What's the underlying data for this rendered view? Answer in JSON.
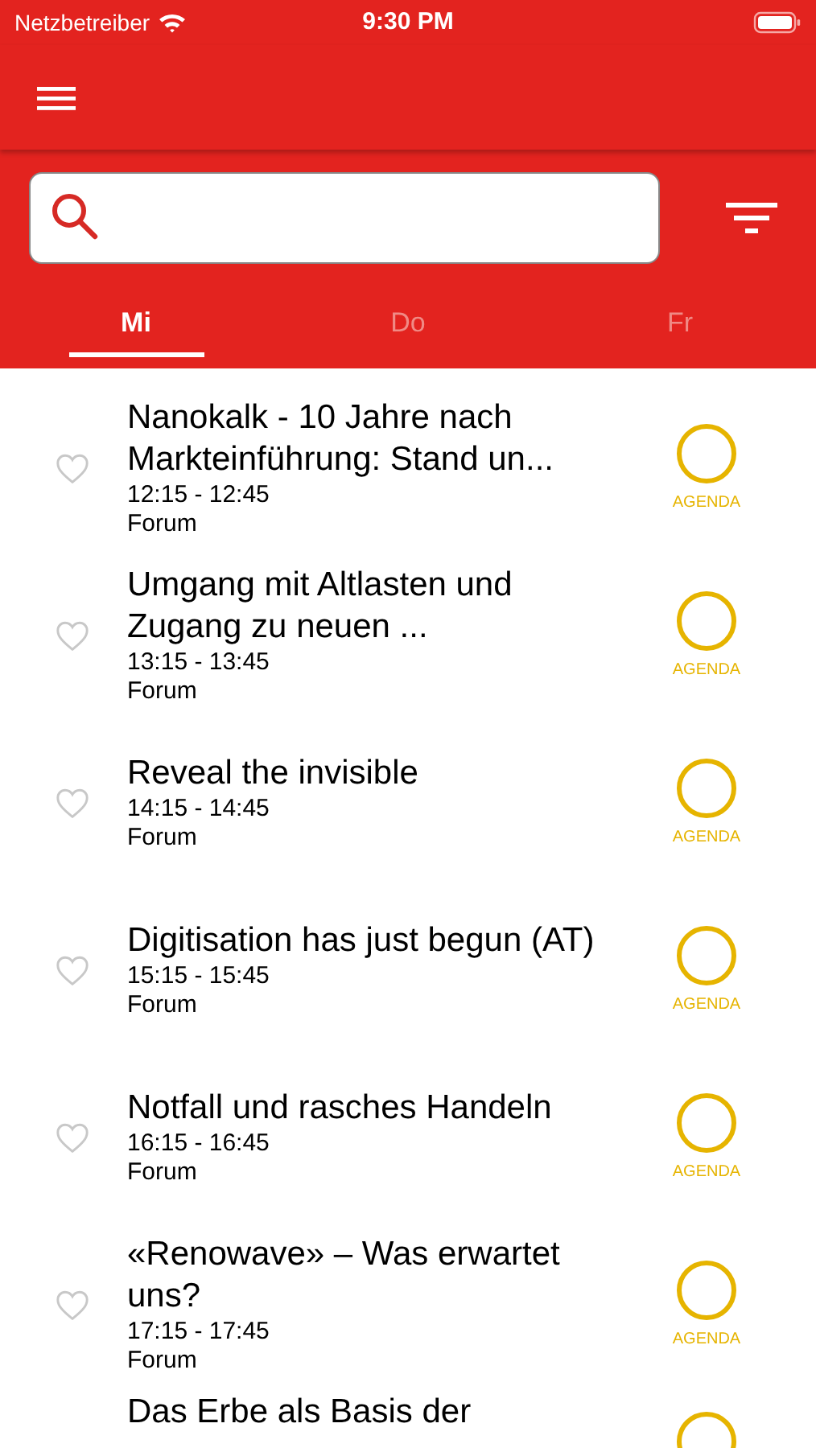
{
  "status_bar": {
    "carrier": "Netzbetreiber",
    "time": "9:30 PM"
  },
  "tabs": [
    {
      "label": "Mi",
      "selected": true
    },
    {
      "label": "Do",
      "selected": false
    },
    {
      "label": "Fr",
      "selected": false
    }
  ],
  "sessions": [
    {
      "title": "Nanokalk - 10 Jahre nach Markteinführung: Stand un...",
      "time": "12:15 - 12:45",
      "room": "Forum",
      "favorite": false,
      "in_agenda": false,
      "agenda_label": "AGENDA"
    },
    {
      "title": "Umgang mit Altlasten und Zugang zu neuen ...",
      "time": "13:15 - 13:45",
      "room": "Forum",
      "favorite": false,
      "in_agenda": false,
      "agenda_label": "AGENDA"
    },
    {
      "title": "Reveal the invisible",
      "time": "14:15 - 14:45",
      "room": "Forum",
      "favorite": false,
      "in_agenda": false,
      "agenda_label": "AGENDA"
    },
    {
      "title": "Digitisation has just begun (AT)",
      "time": "15:15 - 15:45",
      "room": "Forum",
      "favorite": false,
      "in_agenda": false,
      "agenda_label": "AGENDA"
    },
    {
      "title": "Notfall und rasches Handeln",
      "time": "16:15 - 16:45",
      "room": "Forum",
      "favorite": false,
      "in_agenda": false,
      "agenda_label": "AGENDA"
    },
    {
      "title": "«Renowave» – Was erwartet uns?",
      "time": "17:15 - 17:45",
      "room": "Forum",
      "favorite": false,
      "in_agenda": false,
      "agenda_label": "AGENDA"
    },
    {
      "title": "Das Erbe als Basis der",
      "in_agenda": false
    }
  ]
}
